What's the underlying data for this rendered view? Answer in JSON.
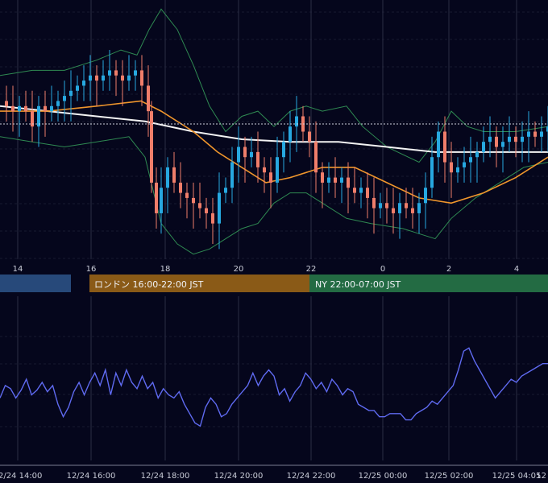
{
  "colors": {
    "background": "#05061c",
    "grid": "#2a2d45",
    "candle_up": "#27a8e0",
    "candle_down": "#f07e6a",
    "bollinger": "#2f8a52",
    "ma_short": "#f0962c",
    "ma_long": "#f3f3f3",
    "oscillator": "#5f6af0",
    "session_tokyo": "#27497a",
    "session_london": "#8a5a17",
    "session_ny": "#236b43"
  },
  "sessions": [
    {
      "name": "tokyo",
      "label": ""
    },
    {
      "name": "london",
      "label": "ロンドン 16:00-22:00 JST"
    },
    {
      "name": "ny",
      "label": "NY 22:00-07:00 JST"
    }
  ],
  "chart_data": [
    {
      "type": "candlestick",
      "panel": "price",
      "x_ticks": [
        "14",
        "16",
        "18",
        "20",
        "22",
        "0",
        "2",
        "4"
      ],
      "y_range": [
        0,
        100
      ],
      "grid": true,
      "overlays": [
        "bollinger bands",
        "moving average (short)",
        "moving average (long)"
      ],
      "current_level": 53
    },
    {
      "type": "line",
      "panel": "oscillator",
      "x_ticks": [
        "12/24 14:00",
        "12/24 16:00",
        "12/24 18:00",
        "12/24 20:00",
        "12/24 22:00",
        "12/25 00:00",
        "12/25 02:00",
        "12/25 04:05",
        "12"
      ],
      "y_range": [
        0,
        100
      ],
      "values": [
        40,
        48,
        46,
        40,
        45,
        52,
        42,
        45,
        50,
        44,
        48,
        36,
        28,
        34,
        44,
        50,
        42,
        50,
        56,
        48,
        58,
        42,
        56,
        48,
        58,
        50,
        46,
        54,
        46,
        50,
        40,
        46,
        42,
        40,
        44,
        36,
        30,
        24,
        22,
        34,
        40,
        36,
        28,
        30,
        36,
        40,
        44,
        48,
        56,
        48,
        54,
        58,
        54,
        42,
        46,
        38,
        44,
        48,
        56,
        52,
        46,
        50,
        44,
        52,
        48,
        42,
        46,
        44,
        36,
        34,
        32,
        32,
        28,
        28,
        30,
        30,
        30,
        26,
        26,
        30,
        32,
        34,
        38,
        36,
        40,
        44,
        48,
        58,
        70,
        72,
        64,
        58,
        52,
        46,
        40,
        44,
        48,
        52,
        50,
        54,
        56,
        58,
        60,
        62,
        62
      ]
    }
  ]
}
